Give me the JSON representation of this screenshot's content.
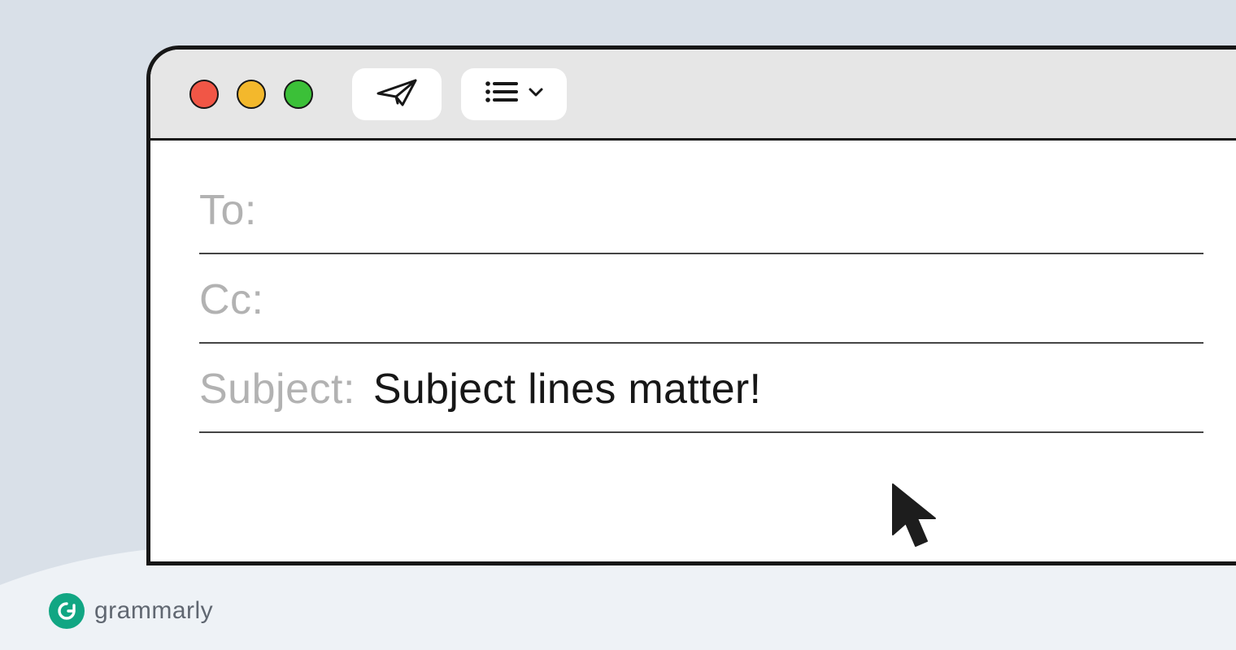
{
  "brand": {
    "name": "grammarly",
    "logo_letter": "G",
    "logo_color": "#11a683"
  },
  "window": {
    "traffic_lights": [
      "close",
      "minimize",
      "zoom"
    ],
    "toolbar": {
      "send_icon": "paper-plane-icon",
      "format_icon": "list-icon",
      "dropdown_icon": "chevron-down-icon"
    }
  },
  "compose": {
    "to_label": "To:",
    "to_value": "",
    "cc_label": "Cc:",
    "cc_value": "",
    "subject_label": "Subject:",
    "subject_value": "Subject lines matter!"
  },
  "cursor": {
    "name": "pointer-cursor"
  }
}
